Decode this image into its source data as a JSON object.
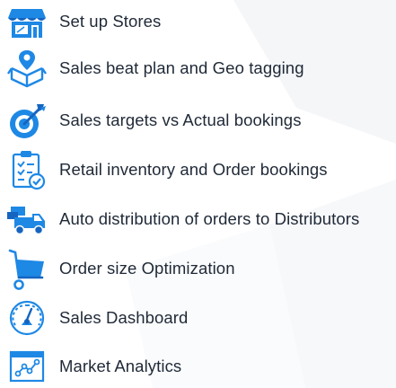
{
  "colors": {
    "icon_primary": "#1e88e5",
    "icon_dark": "#1565c0",
    "text": "#1f2937"
  },
  "features": [
    {
      "label": "Set up Stores",
      "icon": "store-icon"
    },
    {
      "label": "Sales beat plan and Geo tagging",
      "icon": "geo-tag-box-icon"
    },
    {
      "label": "Sales targets vs Actual bookings",
      "icon": "target-arrow-icon"
    },
    {
      "label": "Retail inventory and Order bookings",
      "icon": "clipboard-check-icon"
    },
    {
      "label": "Auto distribution of orders to Distributors",
      "icon": "delivery-truck-icon"
    },
    {
      "label": "Order size Optimization",
      "icon": "shopping-cart-icon"
    },
    {
      "label": "Sales Dashboard",
      "icon": "speedometer-icon"
    },
    {
      "label": "Market Analytics",
      "icon": "analytics-chart-icon"
    }
  ]
}
